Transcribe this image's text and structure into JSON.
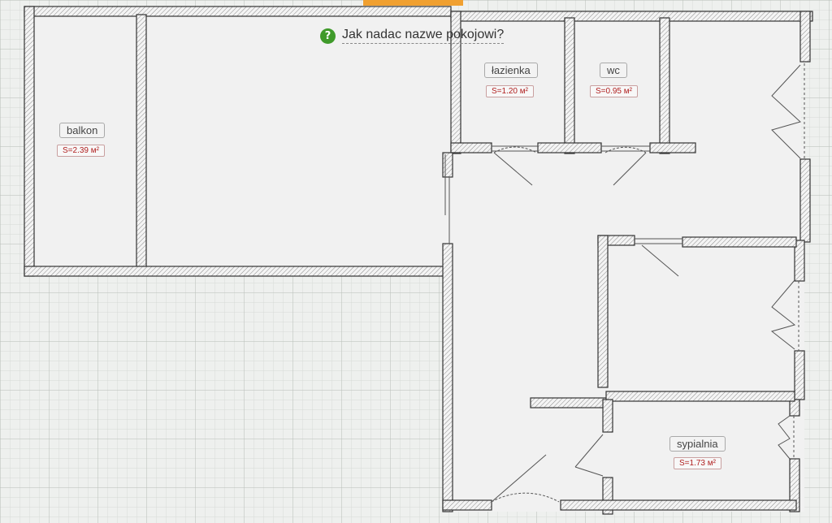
{
  "hint": {
    "icon": "question-icon",
    "icon_glyph": "?",
    "text": "Jak nadac nazwe pokojowi?"
  },
  "rooms": [
    {
      "name": "balkon",
      "area": "S=2.39 м²"
    },
    {
      "name": "łazienka",
      "area": "S=1.20 м²"
    },
    {
      "name": "wc",
      "area": "S=0.95 м²"
    },
    {
      "name": "sypialnia",
      "area": "S=1.73 м²"
    }
  ],
  "colors": {
    "accent_tab": "#f0a030",
    "hint_icon": "#3f9a2a",
    "area_text": "#b02020"
  }
}
